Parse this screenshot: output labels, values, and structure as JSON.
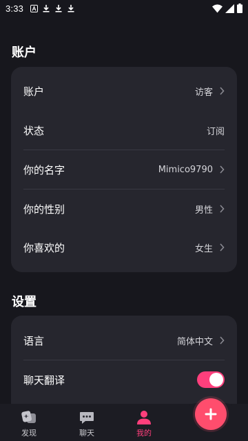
{
  "status_bar": {
    "time": "3:33"
  },
  "colors": {
    "background": "#17171d",
    "card": "#26262e",
    "accent": "#ff3f7c",
    "fab": "#ff4d6d"
  },
  "account_section": {
    "title": "账户",
    "rows": [
      {
        "label": "账户",
        "value": "访客",
        "chevron": true
      },
      {
        "label": "状态",
        "value": "订阅",
        "chevron": false
      },
      {
        "label": "你的名字",
        "value": "Mimico9790",
        "chevron": true
      },
      {
        "label": "你的性别",
        "value": "男性",
        "chevron": true
      },
      {
        "label": "你喜欢的",
        "value": "女生",
        "chevron": true
      }
    ]
  },
  "settings_section": {
    "title": "设置",
    "rows": [
      {
        "label": "语言",
        "value": "简体中文",
        "chevron": true
      },
      {
        "label": "聊天翻译",
        "toggle_on": true
      }
    ]
  },
  "bottom_nav": {
    "items": [
      {
        "label": "发现",
        "icon": "discover-icon",
        "active": false
      },
      {
        "label": "聊天",
        "icon": "chat-icon",
        "active": false
      },
      {
        "label": "我的",
        "icon": "profile-icon",
        "active": true
      }
    ],
    "fab_icon": "plus-icon"
  }
}
